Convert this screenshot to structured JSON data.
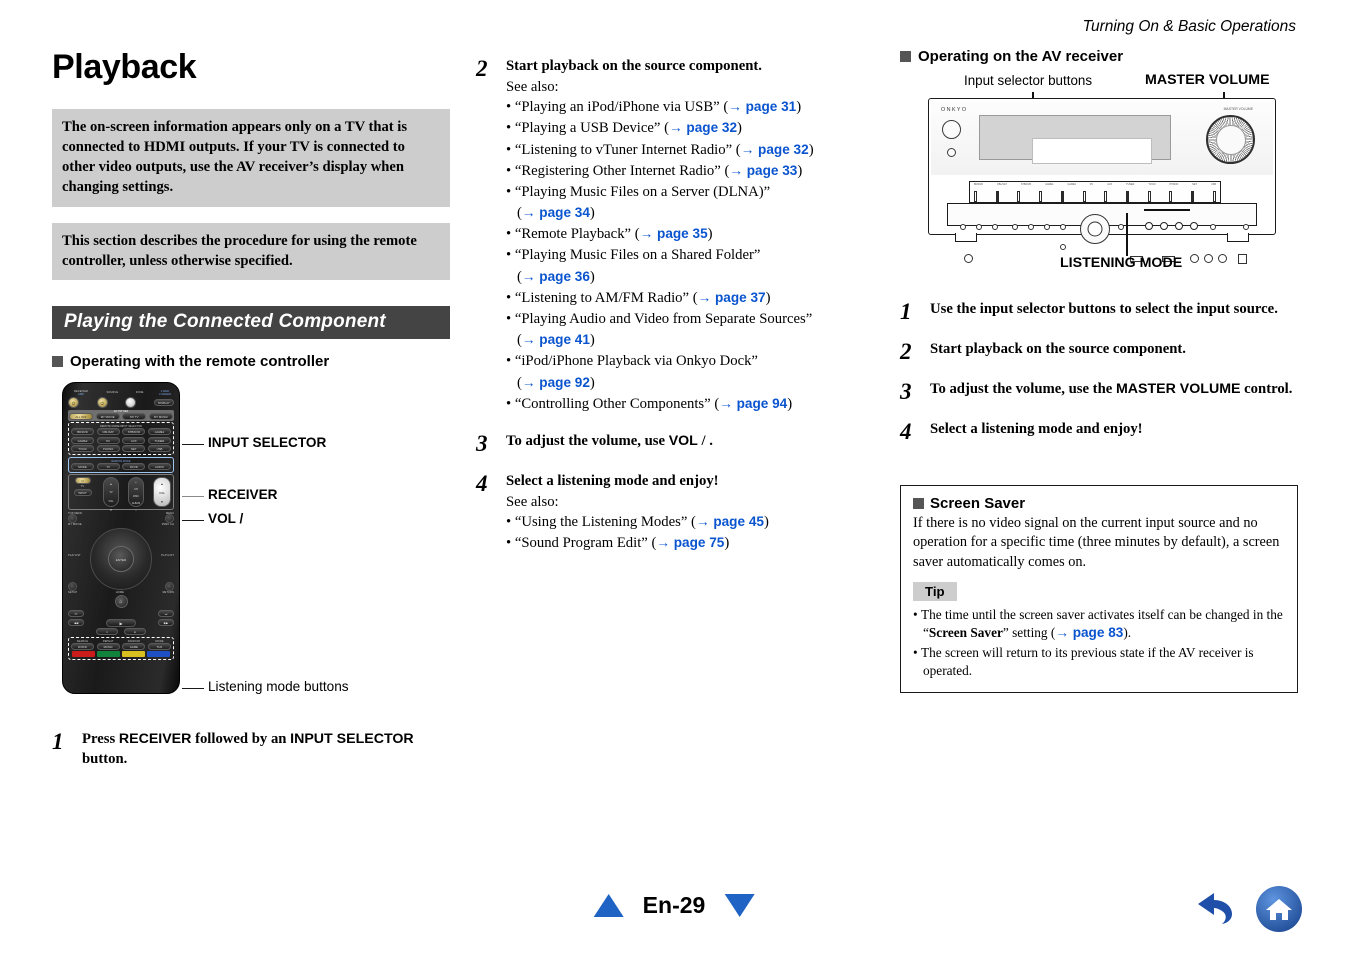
{
  "running_head": "Turning On & Basic Operations",
  "left": {
    "title": "Playback",
    "notes": [
      "The on-screen information appears only on a TV that is connected to HDMI outputs. If your TV is connected to other video outputs, use the AV receiver’s display when changing settings.",
      "This section describes the procedure for using the remote controller, unless otherwise specified."
    ],
    "section_bar": "Playing the Connected Component",
    "sub_head": "Operating with the remote controller",
    "callouts": {
      "input_selector": "INPUT SELECTOR",
      "receiver": "RECEIVER",
      "vol": "VOL    /",
      "listening_mode_buttons": "Listening mode buttons"
    },
    "remote": {
      "labels": {
        "receiver_amp": "RECEIVER\nAMP",
        "source": "SOURCE",
        "zone": "ZONE",
        "zone2": "2 RCV\n3 GREEN",
        "display": "DISPLAY",
        "activities": "ACTIVITIES",
        "remote_mode_input_selector": "REMOTE MODE/INPUT SELECTOR",
        "remote_mode": "REMOTE MODE",
        "amp": "AMP",
        "top_menu": "TOP MENU",
        "menu": "MENU",
        "my_movie": "MY MOVIE",
        "prev_ch": "PREV CH",
        "playlist_l": "PLAYLIST",
        "playlist_r": "PLAYLIST",
        "enter": "ENTER",
        "setup": "SETUP",
        "home": "HOME",
        "return": "RETURN",
        "tv": "TV",
        "tv_vol": "TV\nVOL",
        "ch_disc": "CH\nDISC",
        "album": "ALBUM",
        "vol": "VOL",
        "input": "INPUT",
        "search": "SEARCH",
        "repeat": "REPEAT",
        "random": "RANDOM",
        "mode": "MODE"
      },
      "activity_buttons": [
        "ALL OFF",
        "MY MOVIE",
        "MY TV",
        "MY MUSIC"
      ],
      "input_buttons": [
        "BD/DVD",
        "CBL/SAT",
        "STB/DVR",
        "GAME1",
        "GAME2",
        "PC",
        "AUX",
        "TUNER",
        "TV/CD",
        "PHONO",
        "NET",
        "USB"
      ],
      "mode_buttons": [
        "MODE",
        "TV",
        "RCVR",
        "AUDIO"
      ],
      "bottom_buttons": [
        "DVD/D",
        "MUSIC",
        "GAME",
        "THX"
      ],
      "bottom_colors": [
        "#cc1b1b",
        "#10823c",
        "#d8c020",
        "#1f4fc4"
      ]
    },
    "step1": {
      "num": "1",
      "parts": [
        "Press ",
        "RECEIVER",
        " followed by an ",
        "INPUT SELECTOR",
        " button."
      ]
    }
  },
  "middle": {
    "step2": {
      "num": "2",
      "title": "Start playback on the source component.",
      "see_also": "See also:",
      "bullets": [
        {
          "text": "“Playing an iPod/iPhone via USB”",
          "page": "page 31",
          "wrap": false
        },
        {
          "text": "“Playing a USB Device”",
          "page": "page 32",
          "wrap": false
        },
        {
          "text": "“Listening to vTuner Internet Radio”",
          "page": "page 32",
          "wrap": false
        },
        {
          "text": "“Registering Other Internet Radio”",
          "page": "page 33",
          "wrap": false
        },
        {
          "text": "“Playing Music Files on a Server (DLNA)”",
          "page": "page 34",
          "wrap": true
        },
        {
          "text": "“Remote Playback”",
          "page": "page 35",
          "wrap": false
        },
        {
          "text": "“Playing Music Files on a Shared Folder”",
          "page": "page 36",
          "wrap": true
        },
        {
          "text": "“Listening to AM/FM Radio”",
          "page": "page 37",
          "wrap": false
        },
        {
          "text": "“Playing Audio and Video from Separate Sources”",
          "page": "page 41",
          "wrap": true
        },
        {
          "text": "“iPod/iPhone Playback via Onkyo Dock”",
          "page": "page 92",
          "wrap": true
        },
        {
          "text": "“Controlling Other Components”",
          "page": "page 94",
          "wrap": false
        }
      ]
    },
    "step3": {
      "num": "3",
      "title_pre": "To adjust the volume, use ",
      "title_key": "VOL",
      "title_post": "    /    ."
    },
    "step4": {
      "num": "4",
      "title": "Select a listening mode and enjoy!",
      "see_also": "See also:",
      "bullets": [
        {
          "text": "“Using the Listening Modes”",
          "page": "page 45"
        },
        {
          "text": "“Sound Program Edit”",
          "page": "page 75"
        }
      ]
    }
  },
  "right": {
    "sub_head": "Operating on the AV receiver",
    "fig_labels": {
      "input_selector_buttons": "Input selector buttons",
      "master_volume": "MASTER VOLUME",
      "listening_mode": "LISTENING MODE"
    },
    "receiver_brand": "ONKYO",
    "receiver_panel_labels": {
      "standby": "STANDBY",
      "volume": "VOLUME",
      "master_volume": "MASTER VOLUME",
      "listening_mode": "LISTENING MODE",
      "inputs": [
        "BD/DVD",
        "CBL/SAT",
        "STB/DVR",
        "GAME1",
        "GAME2",
        "PC",
        "AUX",
        "TUNER",
        "TV/CD",
        "PHONO",
        "NET",
        "USB"
      ]
    },
    "steps": [
      {
        "num": "1",
        "text_plain": "Use the input selector buttons to select the input source."
      },
      {
        "num": "2",
        "text_plain": "Start playback on the source component."
      },
      {
        "num": "3",
        "pre": "To adjust the volume, use the ",
        "key": "MASTER VOLUME",
        "post": " control."
      },
      {
        "num": "4",
        "text_plain": "Select a listening mode and enjoy!"
      }
    ],
    "screen_saver": {
      "heading": "Screen Saver",
      "body": "If there is no video signal on the current input source and no operation for a specific time (three minutes by default), a screen saver automatically comes on.",
      "tip_label": "Tip",
      "tips": [
        {
          "pre": "The time until the screen saver activates itself can be changed in the “",
          "bold": "Screen Saver",
          "mid": "” setting (",
          "page": "page 83",
          "post": ")."
        },
        {
          "plain": "The screen will return to its previous state if the AV receiver is operated."
        }
      ]
    }
  },
  "footer": {
    "page_label": "En-29",
    "prev_icon": "triangle-up-icon",
    "next_icon": "triangle-down-icon",
    "back_icon": "back-arrow-icon",
    "home_icon": "home-icon"
  },
  "colors": {
    "link_blue": "#0a54cf",
    "nav_blue": "#1f63c4",
    "gray_box": "#cdcdcd",
    "section_bar": "#444444"
  }
}
